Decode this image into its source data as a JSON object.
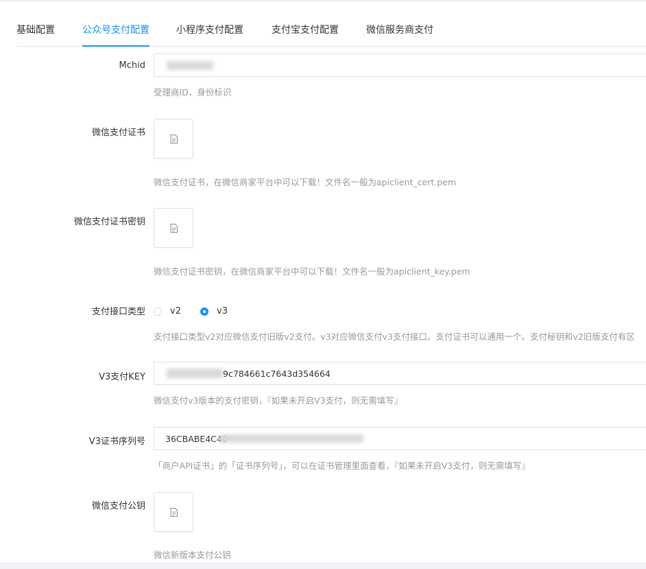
{
  "tabs": [
    {
      "label": "基础配置"
    },
    {
      "label": "公众号支付配置"
    },
    {
      "label": "小程序支付配置"
    },
    {
      "label": "支付宝支付配置"
    },
    {
      "label": "微信服务商支付"
    }
  ],
  "form": {
    "mchid": {
      "label": "Mchid",
      "help": "受理商ID，身份标识"
    },
    "cert": {
      "label": "微信支付证书",
      "help": "微信支付证书，在微信商家平台中可以下载！文件名一般为apiclient_cert.pem"
    },
    "cert_key": {
      "label": "微信支付证书密钥",
      "help": "微信支付证书密钥，在微信商家平台中可以下载！文件名一般为apiclient_key.pem"
    },
    "api_type": {
      "label": "支付接口类型",
      "options": [
        {
          "label": "v2",
          "checked": false
        },
        {
          "label": "v3",
          "checked": true
        }
      ],
      "help": "支付接口类型v2对应微信支付旧版v2支付。v3对应微信支付v3支付接口。支付证书可以通用一个。支付秘钥和v2旧版支付有区"
    },
    "v3_key": {
      "label": "V3支付KEY",
      "value_visible": "9c784661c7643d354664",
      "help": "微信支付v3版本的支付密钥，『如果未开启V3支付，则无需填写』"
    },
    "serial": {
      "label": "V3证书序列号",
      "value_visible": "36CBABE4C40",
      "help": "「商户API证书」的「证书序列号」，可以在证书管理里面查看，『如果未开启V3支付，则无需填写』"
    },
    "public_key": {
      "label": "微信支付公钥",
      "help": "微信新版本支付公钥"
    }
  },
  "colors": {
    "accent": "#1890ff",
    "help_text": "#999999",
    "border": "#dcdfe6"
  },
  "icons": {
    "upload": "file-icon"
  }
}
